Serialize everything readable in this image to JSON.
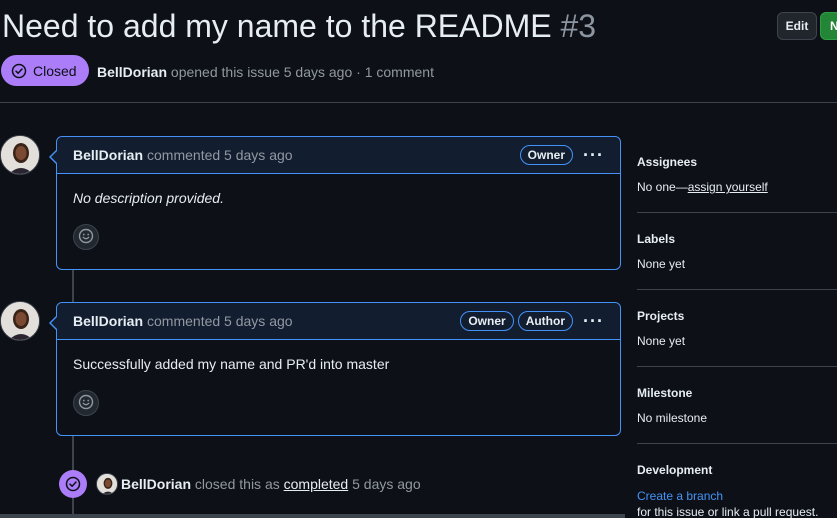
{
  "issue": {
    "title": "Need to add my name to the README",
    "number": "#3",
    "state": "Closed",
    "author": "BellDorian",
    "opened_text": "opened this issue 5 days ago",
    "separator": "·",
    "comment_count": "1 comment"
  },
  "header_buttons": {
    "edit": "Edit",
    "new": "N"
  },
  "comments": [
    {
      "author": "BellDorian",
      "action": "commented 5 days ago",
      "badges": [
        "Owner"
      ],
      "body": "No description provided."
    },
    {
      "author": "BellDorian",
      "action": "commented 5 days ago",
      "badges": [
        "Owner",
        "Author"
      ],
      "body": "Successfully added my name and PR'd into master"
    }
  ],
  "event": {
    "author": "BellDorian",
    "pre": "closed this as",
    "link": "completed",
    "time": "5 days ago"
  },
  "sidebar": {
    "assignees": {
      "title": "Assignees",
      "value_prefix": "No one—",
      "value_link": "assign yourself"
    },
    "labels": {
      "title": "Labels",
      "value": "None yet"
    },
    "projects": {
      "title": "Projects",
      "value": "None yet"
    },
    "milestone": {
      "title": "Milestone",
      "value": "No milestone"
    },
    "development": {
      "title": "Development",
      "link": "Create a branch",
      "sub": "for this issue or link a pull request."
    }
  },
  "colors": {
    "background": "#0d1117",
    "closed_purple": "#ab7df8",
    "accent_blue": "#4493f8",
    "new_green": "#238636"
  },
  "icons": [
    "closed-issue-icon",
    "smiley-icon",
    "kebab-icon",
    "avatar"
  ]
}
